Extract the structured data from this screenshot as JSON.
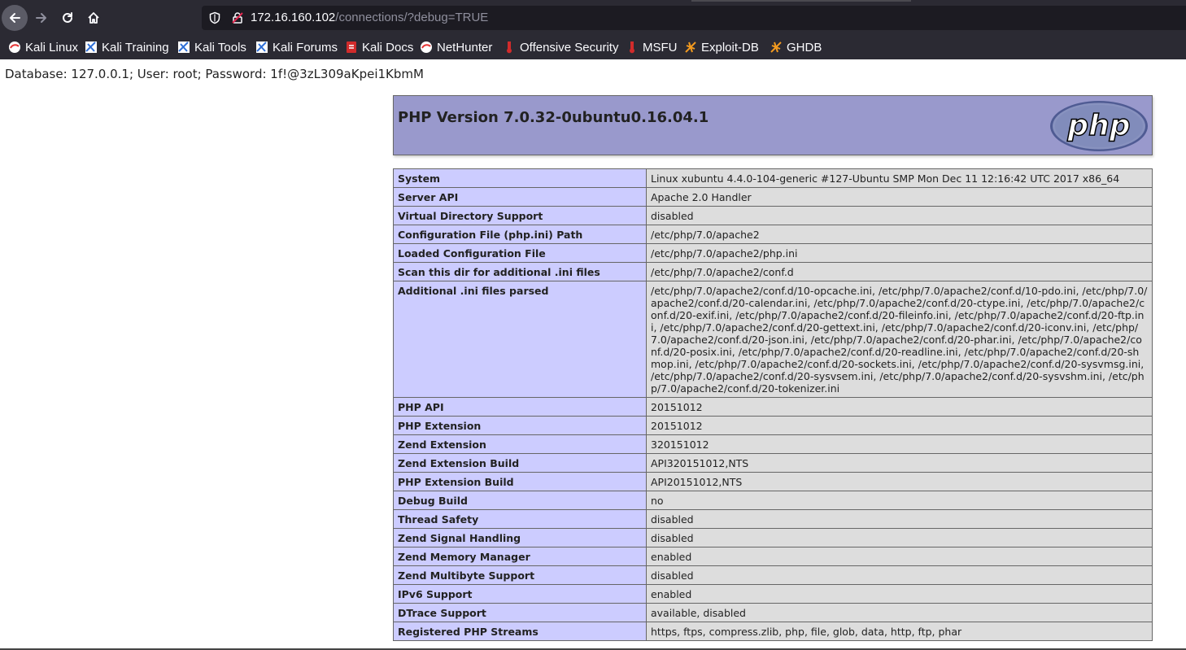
{
  "browser": {
    "url_host": "172.16.160.102",
    "url_path": "/connections/?debug=TRUE",
    "bookmarks": [
      {
        "label": "Kali Linux",
        "icon": "kali-icon"
      },
      {
        "label": "Kali Training",
        "icon": "kali-training-icon"
      },
      {
        "label": "Kali Tools",
        "icon": "kali-tools-icon"
      },
      {
        "label": "Kali Forums",
        "icon": "kali-forums-icon"
      },
      {
        "label": "Kali Docs",
        "icon": "kali-docs-icon"
      },
      {
        "label": "NetHunter",
        "icon": "nethunter-icon"
      },
      {
        "label": "Offensive Security",
        "icon": "offsec-icon"
      },
      {
        "label": "MSFU",
        "icon": "msfu-icon"
      },
      {
        "label": "Exploit-DB",
        "icon": "exploitdb-icon"
      },
      {
        "label": "GHDB",
        "icon": "ghdb-icon"
      }
    ]
  },
  "page": {
    "debug_line": "Database: 127.0.0.1; User: root; Password: 1f!@3zL309aKpei1KbmM",
    "php_title": "PHP Version 7.0.32-0ubuntu0.16.04.1",
    "logo_text": "php",
    "rows": [
      {
        "key": "System",
        "value": "Linux xubuntu 4.4.0-104-generic #127-Ubuntu SMP Mon Dec 11 12:16:42 UTC 2017 x86_64"
      },
      {
        "key": "Server API",
        "value": "Apache 2.0 Handler"
      },
      {
        "key": "Virtual Directory Support",
        "value": "disabled"
      },
      {
        "key": "Configuration File (php.ini) Path",
        "value": "/etc/php/7.0/apache2"
      },
      {
        "key": "Loaded Configuration File",
        "value": "/etc/php/7.0/apache2/php.ini"
      },
      {
        "key": "Scan this dir for additional .ini files",
        "value": "/etc/php/7.0/apache2/conf.d"
      },
      {
        "key": "Additional .ini files parsed",
        "value": "/etc/php/7.0/apache2/conf.d/10-opcache.ini, /etc/php/7.0/apache2/conf.d/10-pdo.ini, /etc/php/7.0/apache2/conf.d/20-calendar.ini, /etc/php/7.0/apache2/conf.d/20-ctype.ini, /etc/php/7.0/apache2/conf.d/20-exif.ini, /etc/php/7.0/apache2/conf.d/20-fileinfo.ini, /etc/php/7.0/apache2/conf.d/20-ftp.ini, /etc/php/7.0/apache2/conf.d/20-gettext.ini, /etc/php/7.0/apache2/conf.d/20-iconv.ini, /etc/php/7.0/apache2/conf.d/20-json.ini, /etc/php/7.0/apache2/conf.d/20-phar.ini, /etc/php/7.0/apache2/conf.d/20-posix.ini, /etc/php/7.0/apache2/conf.d/20-readline.ini, /etc/php/7.0/apache2/conf.d/20-shmop.ini, /etc/php/7.0/apache2/conf.d/20-sockets.ini, /etc/php/7.0/apache2/conf.d/20-sysvmsg.ini, /etc/php/7.0/apache2/conf.d/20-sysvsem.ini, /etc/php/7.0/apache2/conf.d/20-sysvshm.ini, /etc/php/7.0/apache2/conf.d/20-tokenizer.ini"
      },
      {
        "key": "PHP API",
        "value": "20151012"
      },
      {
        "key": "PHP Extension",
        "value": "20151012"
      },
      {
        "key": "Zend Extension",
        "value": "320151012"
      },
      {
        "key": "Zend Extension Build",
        "value": "API320151012,NTS"
      },
      {
        "key": "PHP Extension Build",
        "value": "API20151012,NTS"
      },
      {
        "key": "Debug Build",
        "value": "no"
      },
      {
        "key": "Thread Safety",
        "value": "disabled"
      },
      {
        "key": "Zend Signal Handling",
        "value": "disabled"
      },
      {
        "key": "Zend Memory Manager",
        "value": "enabled"
      },
      {
        "key": "Zend Multibyte Support",
        "value": "disabled"
      },
      {
        "key": "IPv6 Support",
        "value": "enabled"
      },
      {
        "key": "DTrace Support",
        "value": "available, disabled"
      },
      {
        "key": "Registered PHP Streams",
        "value": "https, ftps, compress.zlib, php, file, glob, data, http, ftp, phar"
      }
    ]
  },
  "colors": {
    "chrome_bg": "#2b2a33",
    "header_bg": "#9999cc",
    "key_bg": "#ccccff",
    "value_bg": "#dddddd"
  }
}
